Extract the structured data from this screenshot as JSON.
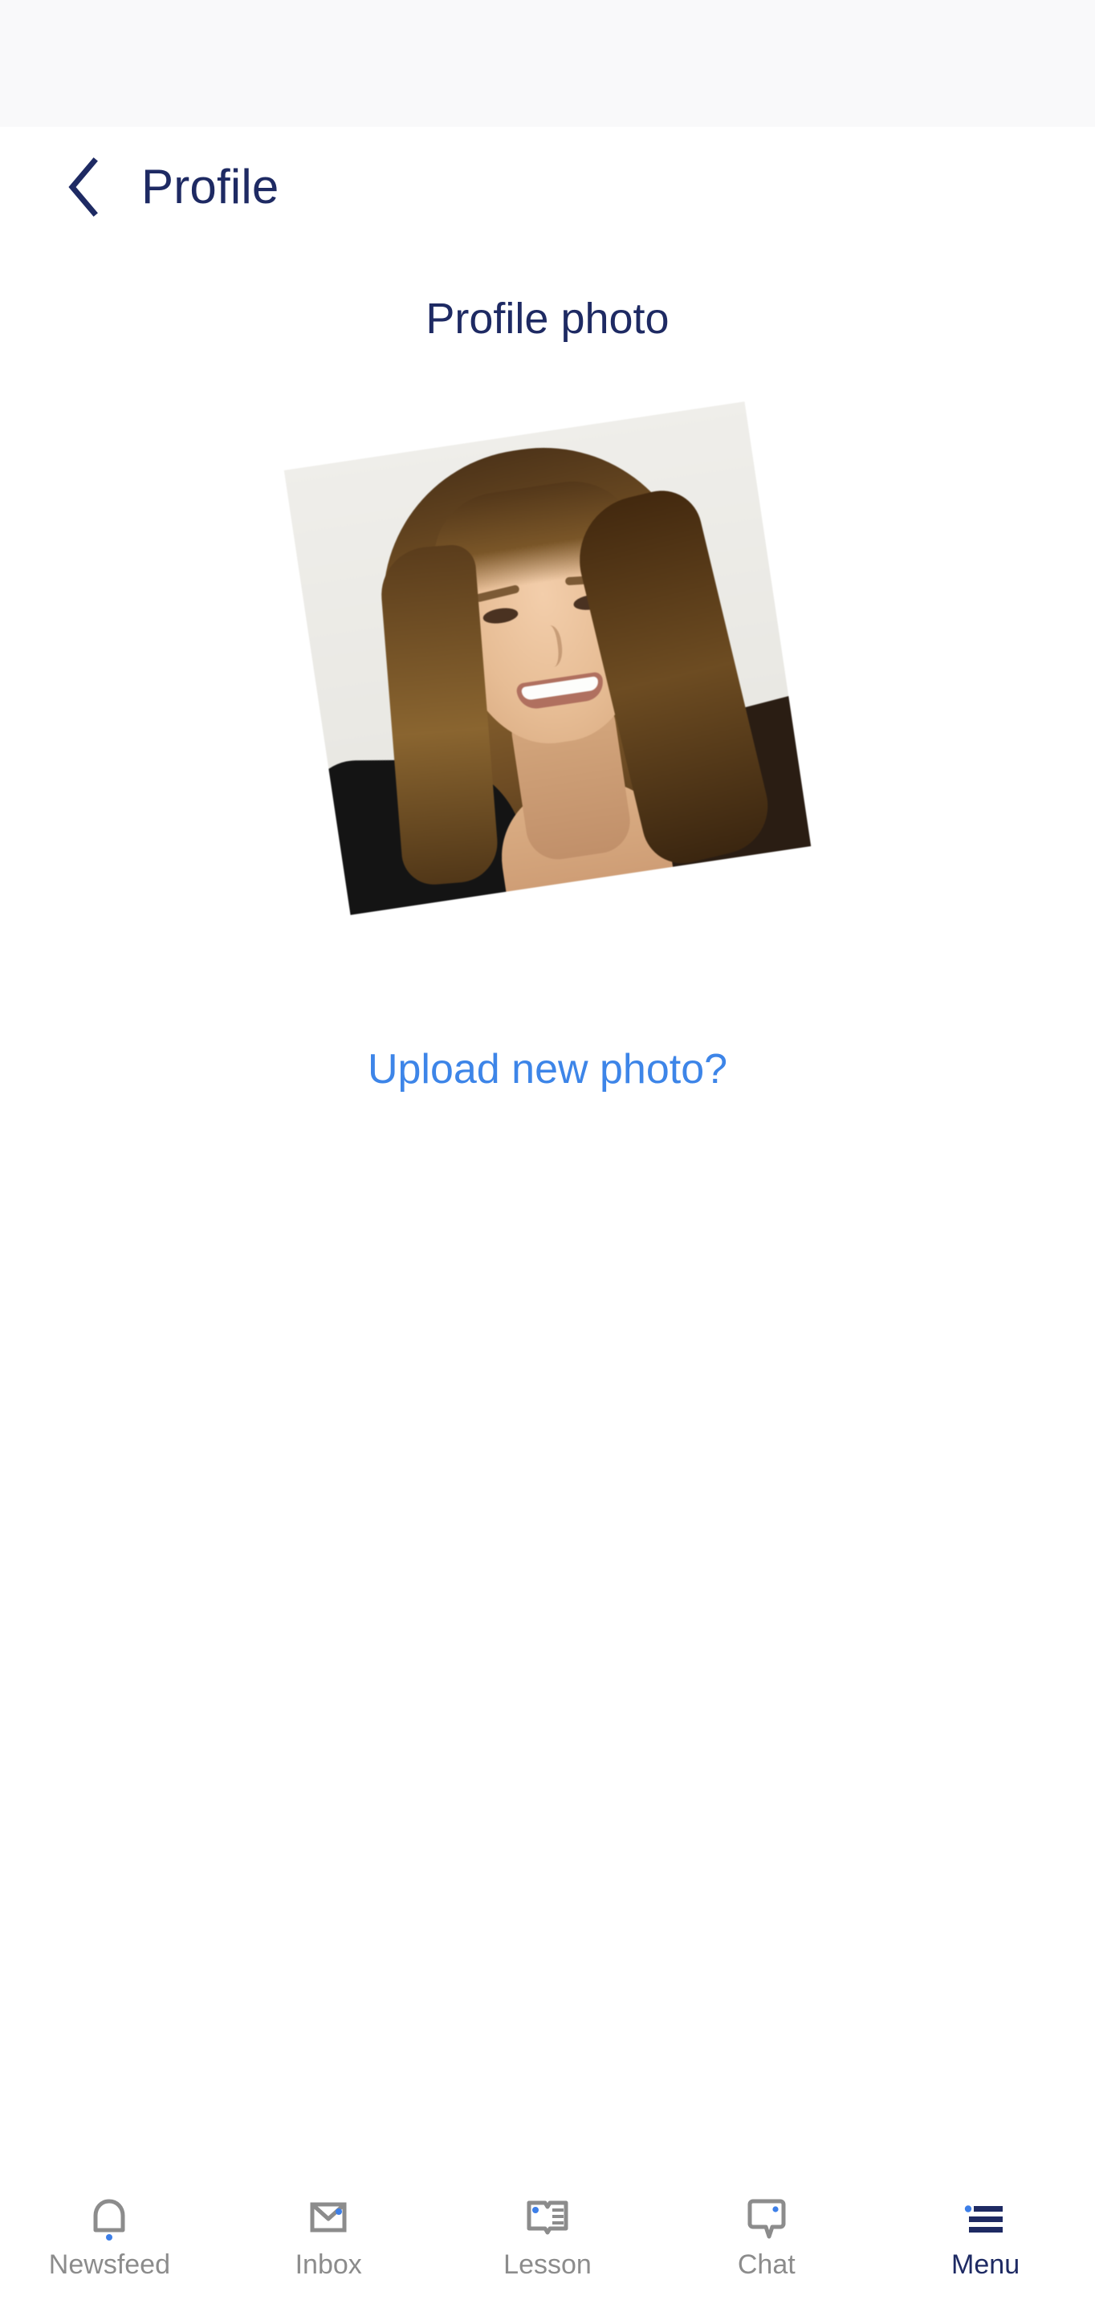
{
  "status_bar": {
    "background": "#f9f9fa"
  },
  "header": {
    "back_icon": "chevron-left-icon",
    "title": "Profile",
    "title_color": "#1e2a63"
  },
  "main": {
    "section_title": "Profile photo",
    "photo": {
      "alt": "profile-photo",
      "description": "Smiling woman with long light-brown hair, light gray background",
      "rotation_deg": -8.5
    },
    "upload_link": "Upload new photo?",
    "upload_link_color": "#3d85e8"
  },
  "bottom_nav": {
    "active_index": 4,
    "inactive_color": "#8c8c8c",
    "active_color": "#1e2a63",
    "dot_color": "#3d7fe8",
    "items": [
      {
        "label": "Newsfeed",
        "icon": "bell-icon",
        "has_dot": true
      },
      {
        "label": "Inbox",
        "icon": "envelope-icon",
        "has_dot": true
      },
      {
        "label": "Lesson",
        "icon": "open-book-icon",
        "has_dot": true
      },
      {
        "label": "Chat",
        "icon": "speech-bubble-icon",
        "has_dot": true
      },
      {
        "label": "Menu",
        "icon": "hamburger-icon",
        "has_dot": true
      }
    ]
  }
}
